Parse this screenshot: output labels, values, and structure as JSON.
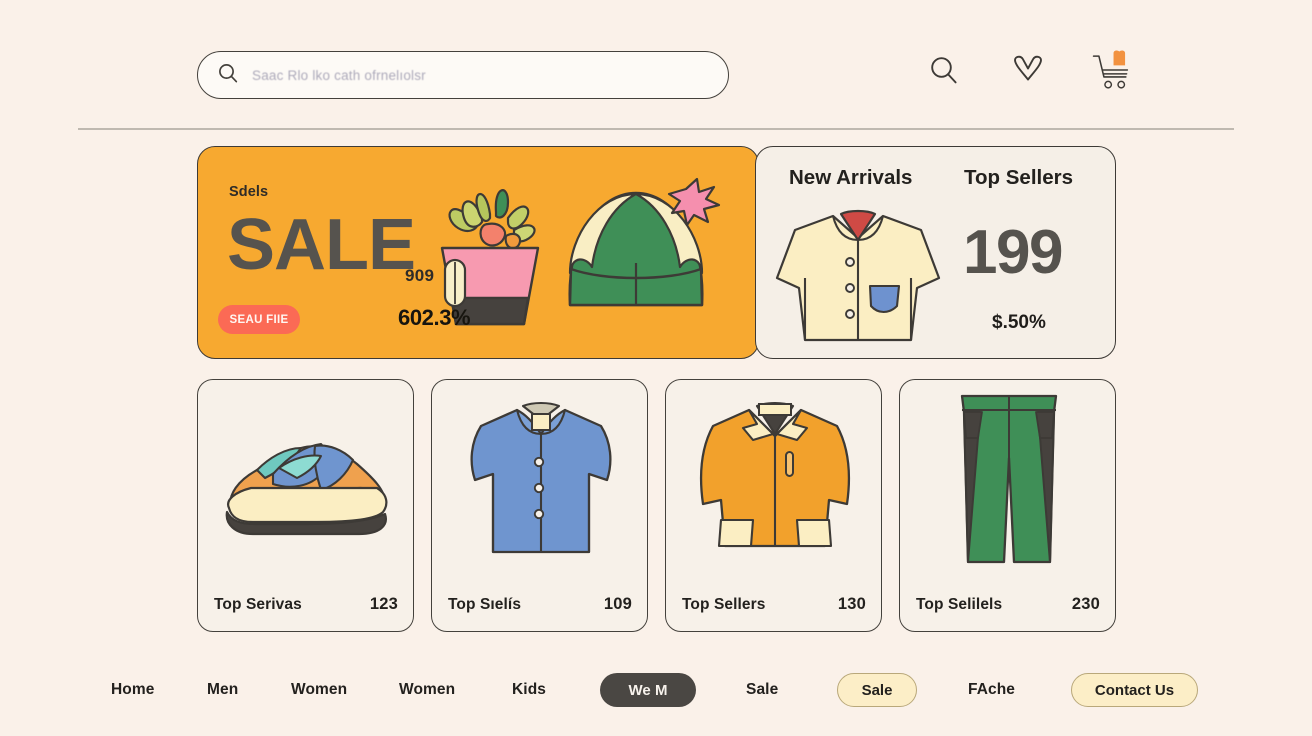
{
  "page": {
    "background": "#faf1e9",
    "accent_orange": "#f7a930",
    "accent_coral": "#fb6a55",
    "accent_cream": "#fceec7",
    "ink": "#23211e"
  },
  "header": {
    "search": {
      "placeholder": "Saac Rlo lko cath ofrnelıolsr",
      "icon": "search-icon"
    },
    "icons": [
      {
        "name": "search-icon",
        "label": "Search"
      },
      {
        "name": "heart-icon",
        "label": "Wishlist"
      },
      {
        "name": "cart-icon",
        "label": "Cart"
      }
    ]
  },
  "hero": {
    "left": {
      "eyebrow": "Sdels",
      "headline": "SALE",
      "cta_label": "SEAU FIIE",
      "basket_number": "909",
      "percent": "602.3%",
      "bg_color": "#f7a930"
    },
    "right": {
      "title_left": "New Arrivals",
      "title_right": "Top Sellers",
      "big_number": "199",
      "sub_number": "$.50%",
      "bg_color": "#f5efe7"
    }
  },
  "products": [
    {
      "name": "Top Serivas",
      "price": "123",
      "art": "sneaker"
    },
    {
      "name": "Top Sıelís",
      "price": "109",
      "art": "shirt"
    },
    {
      "name": "Top Sellers",
      "price": "130",
      "art": "jacket"
    },
    {
      "name": "Top Selilels",
      "price": "230",
      "art": "pants"
    }
  ],
  "bottom_nav": [
    {
      "label": "Home",
      "type": "link"
    },
    {
      "label": "Men",
      "type": "link"
    },
    {
      "label": "Women",
      "type": "link"
    },
    {
      "label": "Women",
      "type": "link"
    },
    {
      "label": "Kids",
      "type": "link"
    },
    {
      "label": "We M",
      "type": "pill-dark"
    },
    {
      "label": "Sale",
      "type": "link"
    },
    {
      "label": "Sale",
      "type": "pill-cream"
    },
    {
      "label": "FAche",
      "type": "link"
    },
    {
      "label": "Contact Us",
      "type": "pill-cream"
    }
  ]
}
